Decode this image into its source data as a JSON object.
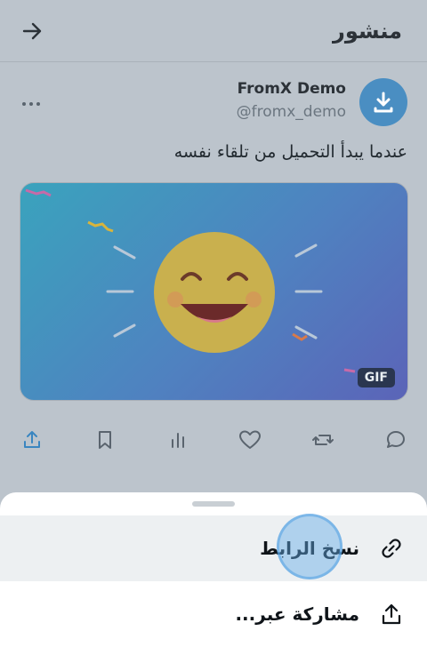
{
  "topbar": {
    "title": "منشور",
    "back_icon": "arrow-right-icon"
  },
  "post": {
    "display_name": "FromX Demo",
    "handle": "@fromx_demo",
    "avatar_icon": "download-icon",
    "more_icon": "ellipsis-icon",
    "text": "عندما يبدأ التحميل من تلقاء نفسه",
    "media_badge": "GIF"
  },
  "actions": [
    "share-icon",
    "bookmark-icon",
    "views-icon",
    "like-icon",
    "retweet-icon",
    "reply-icon"
  ],
  "sheet": {
    "items": [
      {
        "label": "نسخ الرابط",
        "icon": "link-icon"
      },
      {
        "label": "مشاركة عبر...",
        "icon": "share-icon"
      }
    ]
  },
  "colors": {
    "accent": "#4a8ec2",
    "backdrop": "#bcc4cc"
  }
}
